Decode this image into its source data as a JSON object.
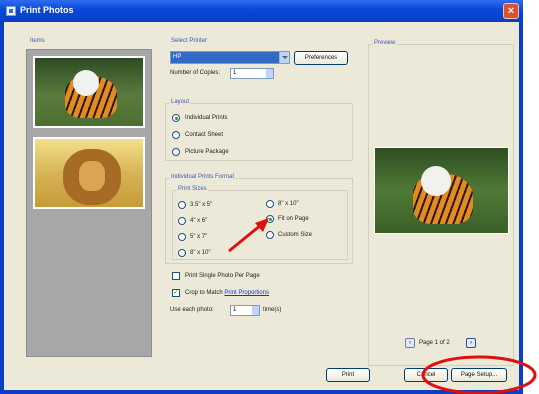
{
  "window": {
    "title": "Print Photos",
    "close_glyph": "×"
  },
  "items": {
    "label": "Items"
  },
  "printer": {
    "group_label": "Select Printer",
    "selected": "HP",
    "preferences_label": "Preferences",
    "copies_label": "Number of Copies:",
    "copies_value": "1"
  },
  "layout": {
    "group_label": "Layout",
    "options": [
      "Individual Prints",
      "Contact Sheet",
      "Picture Package"
    ],
    "selected_index": 0
  },
  "print_format": {
    "group_label": "Individual Prints Format",
    "sizes_label": "Print Sizes",
    "left_options": [
      "3.5\" x 5\"",
      "4\" x 6\"",
      "5\" x 7\"",
      "8\" x 10\""
    ],
    "right_options": [
      "8\" x 10\"",
      "Fit on Page",
      "Custom Size"
    ],
    "selected": "Fit on Page"
  },
  "options": {
    "single_photo_label": "Print Single Photo Per Page",
    "single_photo_checked": false,
    "crop_label": "Crop to Match",
    "crop_link": "Print Proportions",
    "crop_checked": true,
    "use_each_label": "Use each photo:",
    "use_each_value": "1",
    "times_label": "time(s)"
  },
  "preview": {
    "label": "Preview",
    "page_text": "Page 1 of 2"
  },
  "footer": {
    "print_label": "Print",
    "cancel_label": "Cancel",
    "page_setup_label": "Page Setup..."
  },
  "annotation_colors": {
    "arrow": "#e01010",
    "ellipse": "#e01010"
  }
}
